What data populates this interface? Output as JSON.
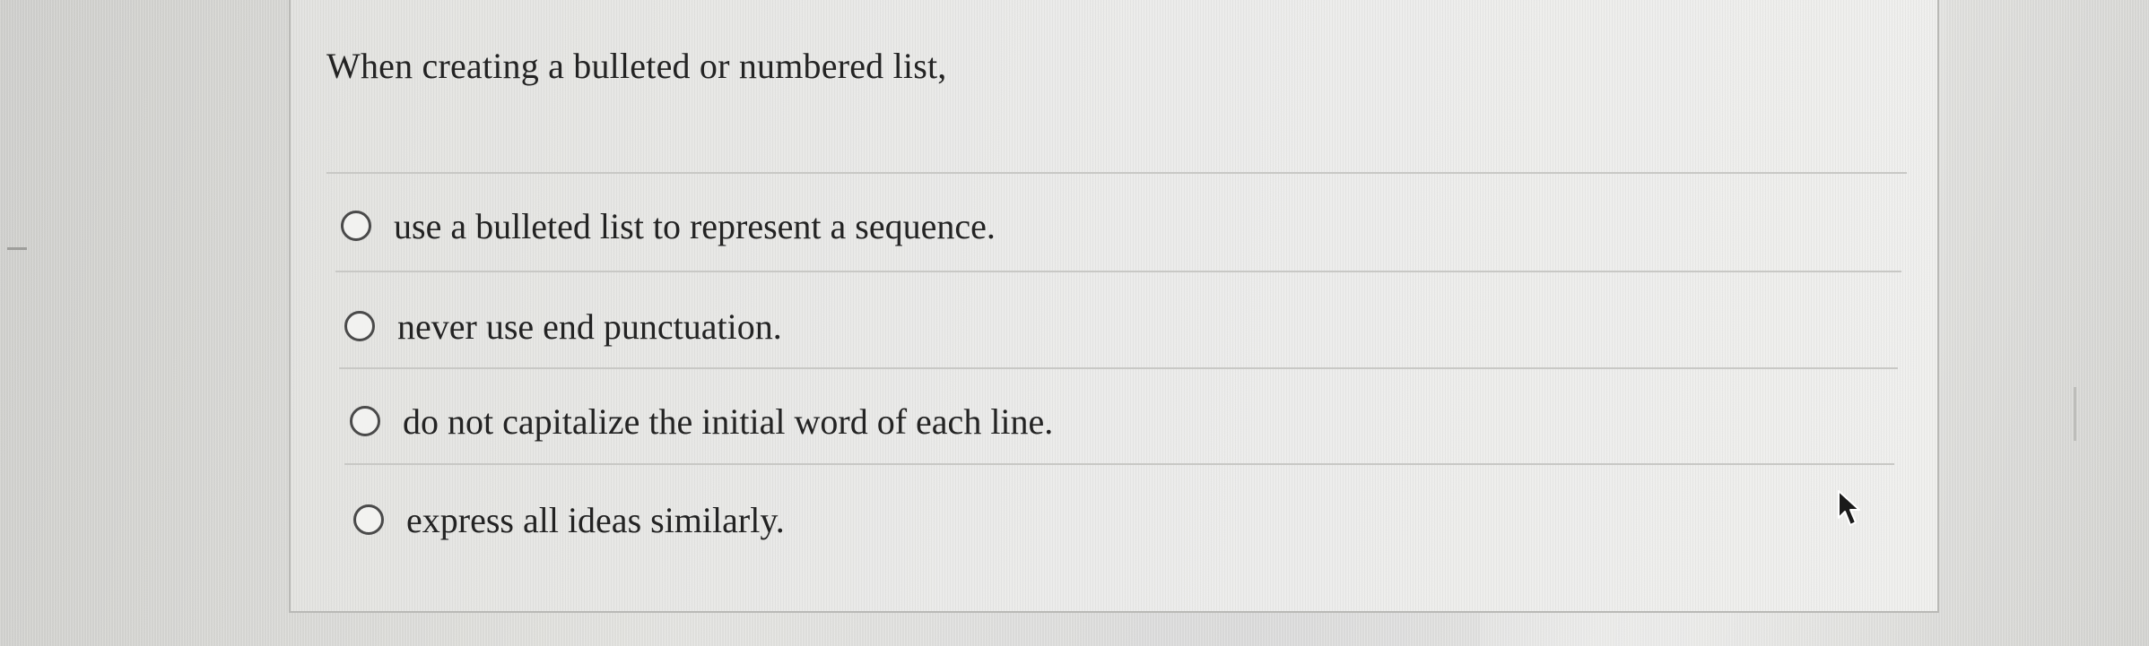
{
  "question": {
    "prompt": "When creating a bulleted or numbered list,",
    "options": [
      {
        "label": "use a bulleted list to represent a sequence.",
        "selected": false
      },
      {
        "label": "never use end punctuation.",
        "selected": false
      },
      {
        "label": "do not capitalize the initial word of each line.",
        "selected": false
      },
      {
        "label": "express all ideas similarly.",
        "selected": false
      }
    ]
  },
  "colors": {
    "text": "#232323",
    "radio_border": "#4a4a4a",
    "divider": "#c8c8c5",
    "card_border": "#b9b9b6"
  },
  "icons": {
    "cursor": "mouse-pointer-arrow"
  }
}
